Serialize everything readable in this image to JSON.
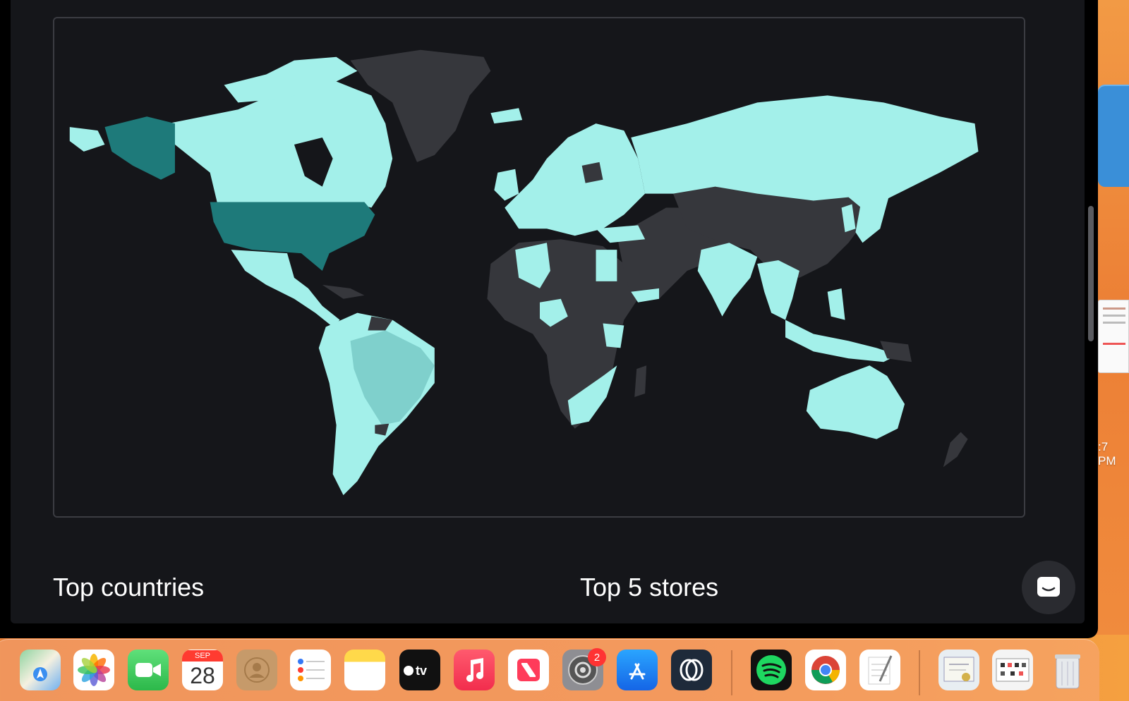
{
  "map": {
    "legend_colors": {
      "highest": "#1e7a7a",
      "high": "#7fd0cc",
      "present": "#a3f0ea",
      "none": "#36373c"
    }
  },
  "sections": {
    "countries_title": "Top countries",
    "stores_title": "Top 5 stores"
  },
  "desktop": {
    "clock_fragment": ":7 PM"
  },
  "dock": {
    "calendar_month": "SEP",
    "calendar_day": "28",
    "system_settings_badge": "2",
    "apps": [
      "Maps",
      "Photos",
      "FaceTime",
      "Calendar",
      "Contacts",
      "Reminders",
      "Notes",
      "Apple TV",
      "Music",
      "News",
      "System Settings",
      "App Store",
      "Opera",
      "Spotify",
      "Google Chrome",
      "TextEdit",
      "Certificate",
      "Preview",
      "Trash"
    ]
  }
}
